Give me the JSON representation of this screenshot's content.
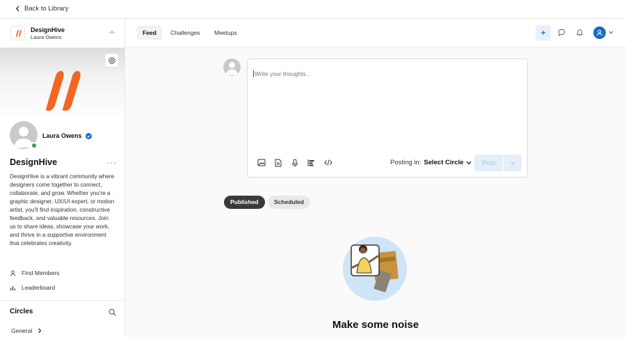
{
  "topbar": {
    "back_label": "Back to Library"
  },
  "community": {
    "name": "DesignHive",
    "owner": "Laura Owens",
    "brand_color": "#f26522",
    "profile_name": "Laura Owens",
    "title": "DesignHive",
    "description": "DesignHive is a vibrant community where designers come together to connect, collaborate, and grow. Whether you're a graphic designer, UX/UI expert, or motion artist, you'll find inspiration, constructive feedback, and valuable resources. Join us to share ideas, showcase your work, and thrive in a supportive environment that celebrates creativity."
  },
  "sidebar": {
    "links": [
      {
        "label": "Find Members",
        "icon": "person-icon"
      },
      {
        "label": "Leaderboard",
        "icon": "bar-chart-icon"
      }
    ],
    "circles_title": "Circles",
    "circles": [
      {
        "label": "General"
      }
    ]
  },
  "tabs": [
    {
      "label": "Feed",
      "active": true
    },
    {
      "label": "Challenges",
      "active": false
    },
    {
      "label": "Meetups",
      "active": false
    }
  ],
  "composer": {
    "placeholder": "Write your thoughts...",
    "posting_in_label": "Posting in:",
    "circle_select": "Select Circle",
    "post_label": "Post"
  },
  "filters": {
    "published": "Published",
    "scheduled": "Scheduled"
  },
  "empty_state": {
    "title": "Make some noise"
  },
  "colors": {
    "accent": "#1b6ec2",
    "online": "#2ea44f"
  }
}
